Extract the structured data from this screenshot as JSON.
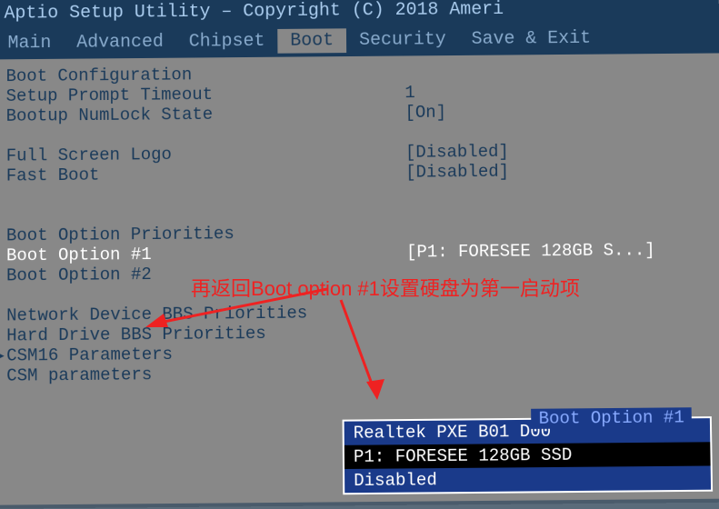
{
  "header": {
    "title": "Aptio Setup Utility – Copyright (C) 2018 Ameri"
  },
  "menu": {
    "items": [
      {
        "label": "Main",
        "active": false
      },
      {
        "label": "Advanced",
        "active": false
      },
      {
        "label": "Chipset",
        "active": false
      },
      {
        "label": "Boot",
        "active": true
      },
      {
        "label": "Security",
        "active": false
      },
      {
        "label": "Save & Exit",
        "active": false
      }
    ]
  },
  "boot": {
    "section_title": "Boot Configuration",
    "rows": [
      {
        "label": "Setup Prompt Timeout",
        "value": "1"
      },
      {
        "label": "Bootup NumLock State",
        "value": "[On]"
      }
    ],
    "rows2": [
      {
        "label": "Full Screen Logo",
        "value": "[Disabled]"
      },
      {
        "label": "Fast Boot",
        "value": "[Disabled]"
      }
    ],
    "priorities_title": "Boot Option Priorities",
    "options": [
      {
        "label": "Boot Option #1",
        "value": "[P1: FORESEE 128GB S...]",
        "highlighted": true
      },
      {
        "label": "Boot Option #2",
        "value": ""
      }
    ],
    "extra": [
      {
        "label": "Network Device BBS Priorities"
      },
      {
        "label": "Hard Drive BBS Priorities"
      },
      {
        "label": "CSM16 Parameters",
        "current": true
      },
      {
        "label": "CSM parameters"
      }
    ]
  },
  "popup": {
    "title": "Boot Option #1",
    "options": [
      {
        "label": "Realtek PXE B01 D00",
        "selected": false
      },
      {
        "label": "P1: FORESEE 128GB SSD",
        "selected": true
      },
      {
        "label": "Disabled",
        "selected": false
      }
    ]
  },
  "annotation": {
    "text": "再返回Boot option #1设置硬盘为第一启动项"
  }
}
